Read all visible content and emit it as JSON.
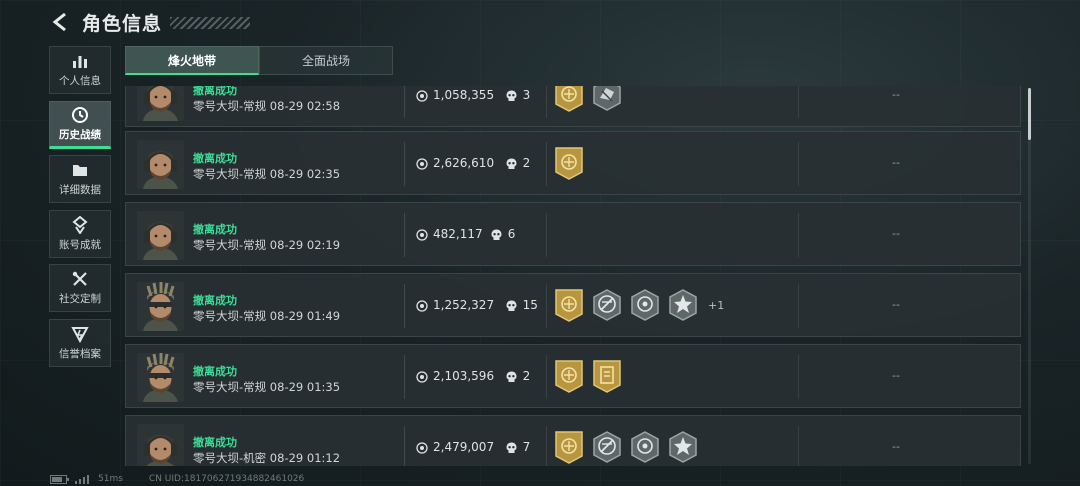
{
  "header": {
    "title": "角色信息"
  },
  "sidebar": {
    "items": [
      {
        "label": "个人信息",
        "icon": "bar-chart-icon",
        "active": false
      },
      {
        "label": "历史战绩",
        "icon": "history-icon",
        "active": true
      },
      {
        "label": "详细数据",
        "icon": "folder-icon",
        "active": false
      },
      {
        "label": "账号成就",
        "icon": "medal-icon",
        "active": false
      },
      {
        "label": "社交定制",
        "icon": "tools-icon",
        "active": false
      },
      {
        "label": "信誉档案",
        "icon": "shield-icon",
        "active": false
      }
    ]
  },
  "tabs": [
    {
      "label": "烽火地带",
      "active": true
    },
    {
      "label": "全面战场",
      "active": false
    }
  ],
  "records": [
    {
      "status": "撤离成功",
      "map": "零号大坝-常规",
      "time": "08-29 02:58",
      "value": "1,058,355",
      "kills": "3",
      "badges": [
        "gold-crest-badge",
        "hand-badge"
      ],
      "extra": "",
      "extra_stat": "--",
      "avatar": "soldier-cap"
    },
    {
      "status": "撤离成功",
      "map": "零号大坝-常规",
      "time": "08-29 02:35",
      "value": "2,626,610",
      "kills": "2",
      "badges": [
        "gold-crest-badge"
      ],
      "extra": "",
      "extra_stat": "--",
      "avatar": "soldier-cap"
    },
    {
      "status": "撤离成功",
      "map": "零号大坝-常规",
      "time": "08-29 02:19",
      "value": "482,117",
      "kills": "6",
      "badges": [],
      "extra": "",
      "extra_stat": "--",
      "avatar": "soldier-cap"
    },
    {
      "status": "撤离成功",
      "map": "零号大坝-常规",
      "time": "08-29 01:49",
      "value": "1,252,327",
      "kills": "15",
      "badges": [
        "gold-crest-badge",
        "no-weapon-badge",
        "crosshair-badge",
        "star-badge"
      ],
      "extra": "+1",
      "extra_stat": "--",
      "avatar": "soldier-helmet"
    },
    {
      "status": "撤离成功",
      "map": "零号大坝-常规",
      "time": "08-29 01:35",
      "value": "2,103,596",
      "kills": "2",
      "badges": [
        "gold-crest-badge",
        "gold-card-badge"
      ],
      "extra": "",
      "extra_stat": "--",
      "avatar": "soldier-helmet"
    },
    {
      "status": "撤离成功",
      "map": "零号大坝-机密",
      "time": "08-29 01:12",
      "value": "2,479,007",
      "kills": "7",
      "badges": [
        "gold-crest-badge",
        "no-weapon-badge",
        "crosshair-badge",
        "star-badge"
      ],
      "extra": "",
      "extra_stat": "--",
      "avatar": "soldier-cap"
    }
  ],
  "footer": {
    "ping": "51ms",
    "uid": "CN UID:1817062719348824610​26"
  },
  "colors": {
    "accent": "#3ddc97",
    "gold": "#b8963f",
    "silver": "#9aa5a6"
  }
}
